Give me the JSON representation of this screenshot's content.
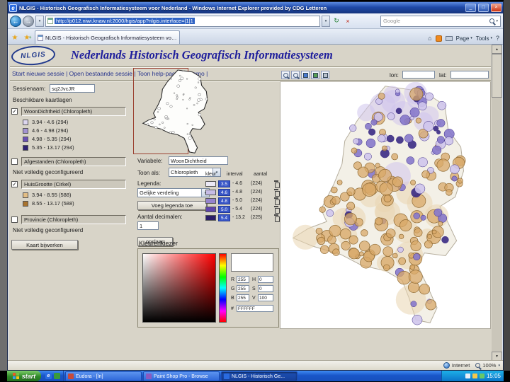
{
  "chrome": {
    "window_title": "NLGIS - Historisch Geografisch Informatiesysteem voor Nederland - Windows Internet Explorer provided by CDG Letteren",
    "url": "http://p012.niwi.knaw.nl:2000/hgis/app?nlgis.interface=|1|1",
    "search_placeholder": "Google",
    "tab_title": "NLGIS - Historisch Geografisch Informatiesysteem voo...",
    "page_menu": "Page",
    "tools_menu": "Tools",
    "status_zone": "Internet",
    "zoom_level": "100%"
  },
  "icons": {
    "window": "e",
    "minimize": "_",
    "maximize": "□",
    "close": "×",
    "back": "←",
    "forward": "→",
    "refresh": "↻",
    "stop": "×",
    "dropdown": "▾",
    "favorites_star": "★",
    "plus": "+",
    "home": "⌂",
    "help": "?",
    "scroll_up": "▲",
    "scroll_down": "▼"
  },
  "page": {
    "logo": "NLGIS",
    "title": "Nederlands Historisch Geografisch Informatiesysteem",
    "nav": [
      "Start nieuwe sessie",
      "Open bestaande sessie",
      "Toon help-pagina",
      "Demo"
    ],
    "session_label": "Sessienaam:",
    "session_value": "sq2JvcJR",
    "layers_heading": "Beschikbare kaartlagen",
    "layers": [
      {
        "name": "WoonDichtheid (Chloropleth)",
        "checked": true,
        "note": "",
        "legend": [
          {
            "color": "#ddd6ef",
            "label": "3.94 - 4.6 (294)"
          },
          {
            "color": "#a393d2",
            "label": "4.6 - 4.98 (294)"
          },
          {
            "color": "#6a50b5",
            "label": "4.98 - 5.35 (294)"
          },
          {
            "color": "#2e2173",
            "label": "5.35 - 13.17 (294)"
          }
        ]
      },
      {
        "name": "Afgestanden (Chloropleth)",
        "checked": false,
        "note": "Niet volledig geconfigureerd",
        "legend": []
      },
      {
        "name": "HuisGrootte (Cirkel)",
        "checked": true,
        "note": "",
        "legend": [
          {
            "color": "#e2bd84",
            "label": "3.94 - 8.55 (588)"
          },
          {
            "color": "#a8732e",
            "label": "8.55 - 13.17 (588)"
          }
        ]
      },
      {
        "name": "Provincie (Chloropleth)",
        "checked": false,
        "note": "Niet volledig geconfigureerd",
        "legend": []
      }
    ],
    "update_button": "Kaart bijwerken",
    "variable_label": "Variabele:",
    "variable_value": "WoonDichtheid",
    "show_as_label": "Toon als:",
    "show_as_value": "Chloropleth",
    "legend_heading": "Legenda:",
    "distribution_value": "Gelijke verdeling",
    "add_legend_button": "Voeg legenda toe",
    "decimals_label": "Aantal decimalen:",
    "decimals_value": "1",
    "save_button": "opslaan",
    "legend_table": {
      "headers": [
        "kleur",
        "interval",
        "aantal"
      ],
      "rows": [
        {
          "color": "#ece9f6",
          "lower": "3.5",
          "upper": "4.6",
          "count": "(224)"
        },
        {
          "color": "#c6bce6",
          "lower": "4.6",
          "upper": "4.8",
          "count": "(224)"
        },
        {
          "color": "#9583cd",
          "lower": "4.8",
          "upper": "5.0",
          "count": "(224)"
        },
        {
          "color": "#5f45ab",
          "lower": "5.0",
          "upper": "5.4",
          "count": "(224)"
        },
        {
          "color": "#2b1d69",
          "lower": "5.4",
          "upper": "13.2",
          "count": "(225)"
        }
      ]
    },
    "color_picker": {
      "title": "Kleurenkiezer",
      "fields": [
        {
          "label": "R",
          "value": "255"
        },
        {
          "label": "G",
          "value": "255"
        },
        {
          "label": "B",
          "value": "255"
        },
        {
          "label": "H",
          "value": "0"
        },
        {
          "label": "S",
          "value": "0"
        },
        {
          "label": "V",
          "value": "100"
        }
      ],
      "hex_label": "#",
      "hex_value": "FFFFFF"
    },
    "map": {
      "lon_label": "lon:",
      "lat_label": "lat:",
      "palette": {
        "tan": "#d8a868",
        "tan_stroke": "#8f6a33",
        "purple_light": "#cfc5ec",
        "purple_mid": "#8678cb",
        "purple_dark": "#3a2a84",
        "underlay_tan": "#e9d6b0"
      }
    }
  },
  "taskbar": {
    "start_label": "start",
    "items": [
      "Eudora - [In]",
      "Paint Shop Pro - Browse",
      "NLGIS - Historisch Ge..."
    ],
    "clock": "15:05"
  }
}
